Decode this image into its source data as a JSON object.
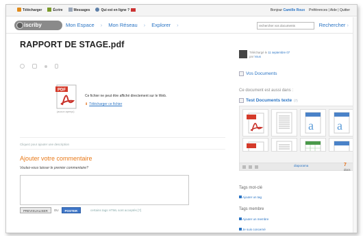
{
  "topbar": {
    "left": [
      "Télécharger",
      "Écrire",
      "Messages",
      "Qui est en ligne ? "
    ],
    "greeting": "Bonjour ",
    "username": "Camille Roux",
    "right_links": "Préférences | Aide | Quitter"
  },
  "nav": {
    "logo": "iscriby",
    "links": [
      "Mon Espace",
      "Mon Réseau",
      "Explorer"
    ],
    "search_placeholder": "rechercher vos documents",
    "search_button": "Rechercher"
  },
  "doc": {
    "title": "RAPPORT DE STAGE.pdf",
    "thumb_caption": "(aucun aperçu)",
    "message": "Ce fichier ne peut être affiché directement sur le Web.",
    "download": "Télécharger ce fichier",
    "add_description": "Cliquez pour ajouter une description"
  },
  "comment": {
    "heading": "Ajouter votre commentaire",
    "question": "Voulez-vous laisser le premier commentaire?",
    "preview_button": "PREVISUALISER",
    "or": "OU",
    "post_button": "POSTER",
    "hint": "certains tags HTML sont acceptés [?]"
  },
  "sidebar": {
    "uploaded_prefix": "Téléchargé le ",
    "uploaded_date": "11 septembre 07",
    "by_prefix": "par ",
    "by_user": "Vous",
    "your_docs": "Vos Documents",
    "also_in": "Ce document est aussi dans :",
    "folder": "Test Documents texte",
    "folder_count": "(7)",
    "slideshow": "diaporama",
    "docs_count": "7",
    "docs_label": " docs",
    "tags_heading": "Tags mot-clé",
    "add_tag": "Ajouter un tag",
    "member_tags_heading": "Tags membre",
    "add_member": "Ajouter un membre",
    "concerned": "Je suis concerné"
  }
}
